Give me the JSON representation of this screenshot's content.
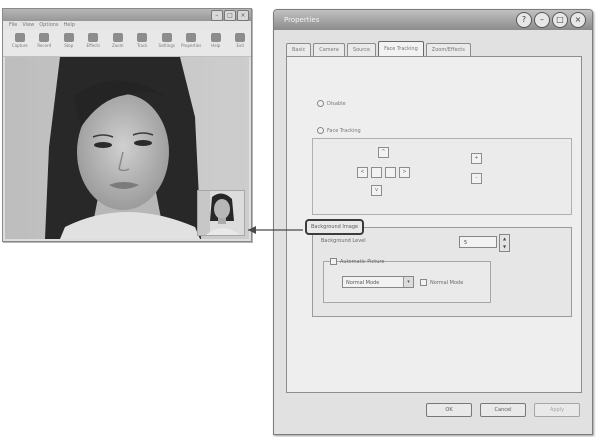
{
  "app_window": {
    "title": "",
    "menu": [
      "File",
      "View",
      "Options",
      "Help"
    ],
    "toolbar": [
      {
        "label": "Capture",
        "icon": "camera-icon"
      },
      {
        "label": "Record",
        "icon": "record-icon"
      },
      {
        "label": "Stop",
        "icon": "stop-icon"
      },
      {
        "label": "Effects",
        "icon": "effects-icon"
      },
      {
        "label": "Zoom",
        "icon": "zoom-icon"
      },
      {
        "label": "Track",
        "icon": "track-icon"
      },
      {
        "label": "Settings",
        "icon": "settings-icon"
      },
      {
        "label": "Properties",
        "icon": "properties-icon"
      },
      {
        "label": "Help",
        "icon": "help-icon"
      },
      {
        "label": "Exit",
        "icon": "exit-icon"
      }
    ]
  },
  "dialog": {
    "title": "Properties",
    "tabs": [
      "Basic",
      "Camera",
      "Source",
      "Face Tracking",
      "Zoom/Effects"
    ],
    "active_tab": 3,
    "radio_1": "Disable",
    "radio_2": "Face Tracking",
    "bi_label": "Background Image",
    "row_label": "Background Level",
    "spin_value": "5",
    "checkbox_label": "Automatic Picture",
    "select_value": "Normal Mode",
    "side_checkbox_label": "Normal Mode",
    "buttons": {
      "ok": "OK",
      "cancel": "Cancel",
      "apply": "Apply"
    }
  }
}
